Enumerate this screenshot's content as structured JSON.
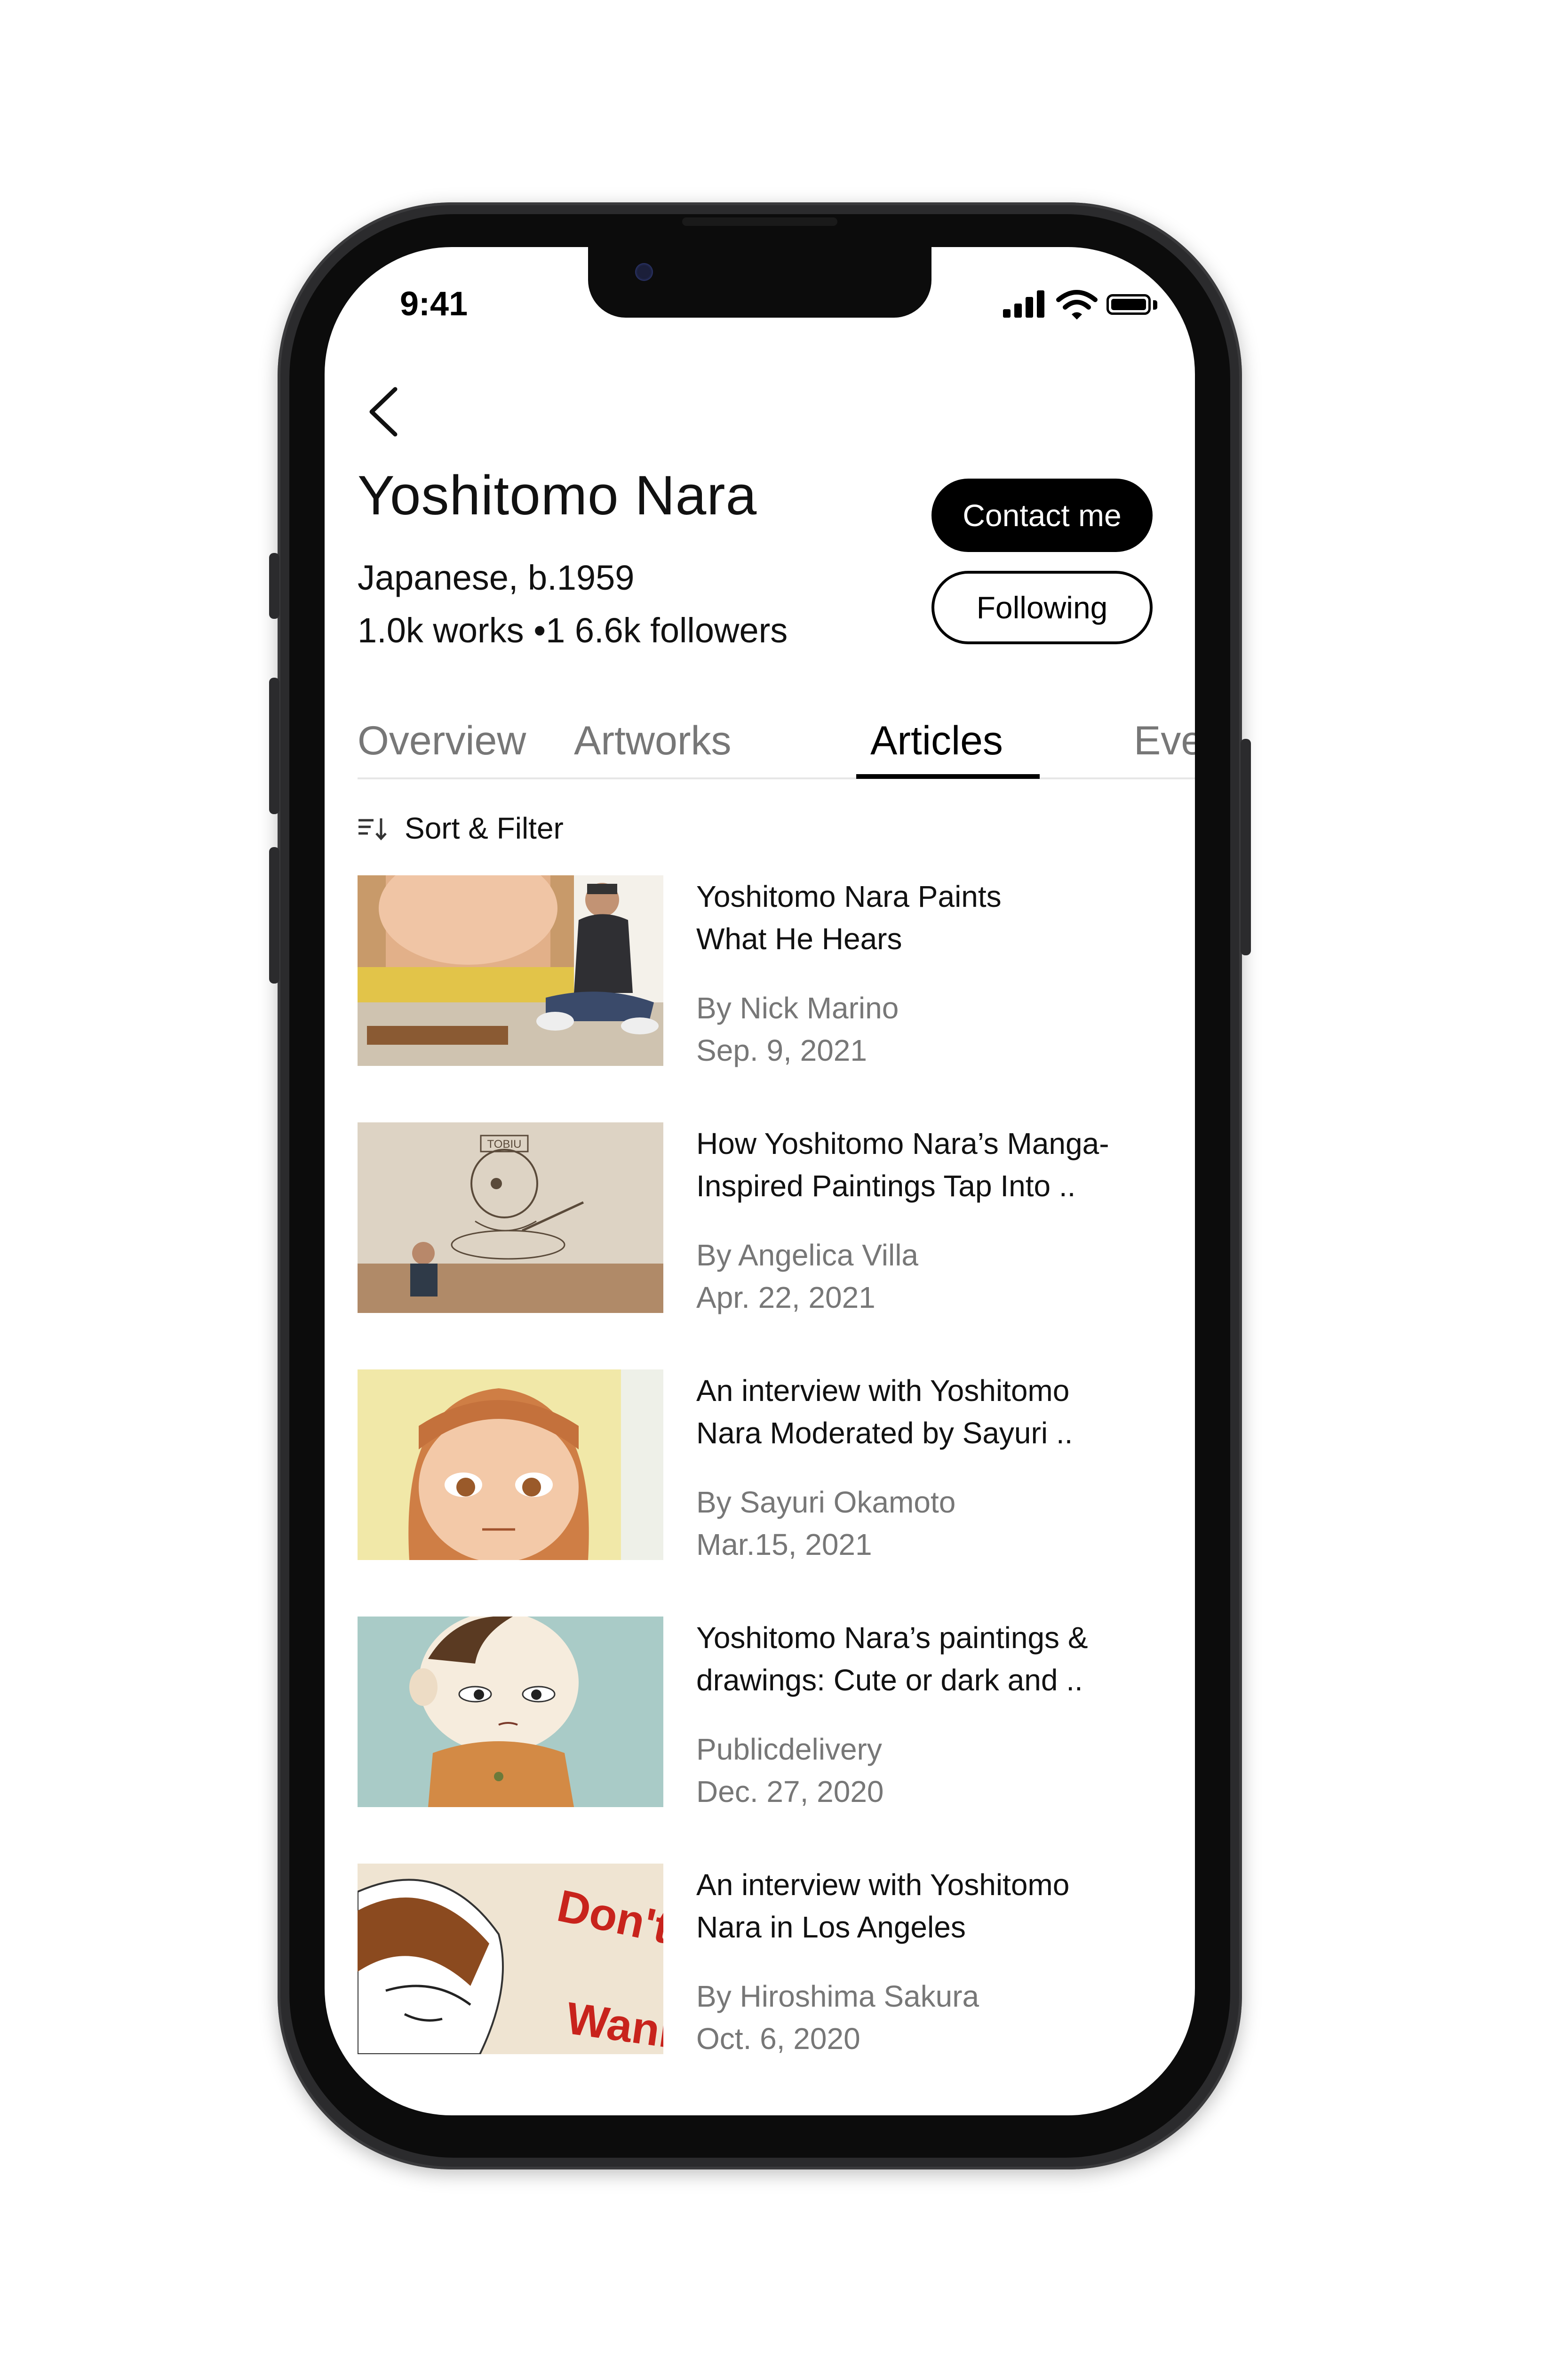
{
  "status_bar": {
    "time": "9:41"
  },
  "artist": {
    "name": "Yoshitomo Nara",
    "nationality": "Japanese, b.1959",
    "stats": "1.0k works •1 6.6k followers"
  },
  "actions": {
    "contact_label": "Contact me",
    "follow_label": "Following"
  },
  "tabs": [
    {
      "label": "Overview",
      "active": false
    },
    {
      "label": "Artworks",
      "active": false
    },
    {
      "label": "Articles",
      "active": true
    },
    {
      "label": "Ever",
      "active": false
    }
  ],
  "sort": {
    "label": "Sort & Filter"
  },
  "articles": [
    {
      "title": "Yoshitomo Nara Paints\n What He Hears",
      "author": "By Nick Marino",
      "date": "Sep. 9, 2021"
    },
    {
      "title": "How Yoshitomo Nara’s Manga-\nInspired Paintings Tap Into ..",
      "author": "By Angelica Villa",
      "date": "Apr. 22, 2021"
    },
    {
      "title": "An interview with Yoshitomo\nNara Moderated by Sayuri ..",
      "author": "By Sayuri Okamoto",
      "date": "Mar.15, 2021"
    },
    {
      "title": "Yoshitomo Nara’s paintings &\ndrawings: Cute or dark and ..",
      "author": "Publicdelivery",
      "date": "Dec. 27, 2020"
    },
    {
      "title": "An interview with Yoshitomo\nNara in Los Angeles",
      "author": "By  Hiroshima Sakura",
      "date": "Oct. 6, 2020"
    }
  ],
  "thumb_text": {
    "article_2": "TOBIU",
    "article_5_line1": "Don't",
    "article_5_line2": "Wann"
  },
  "colors": {
    "accent": "#000000",
    "muted_text": "#777777",
    "divider": "#e6e6e6"
  }
}
